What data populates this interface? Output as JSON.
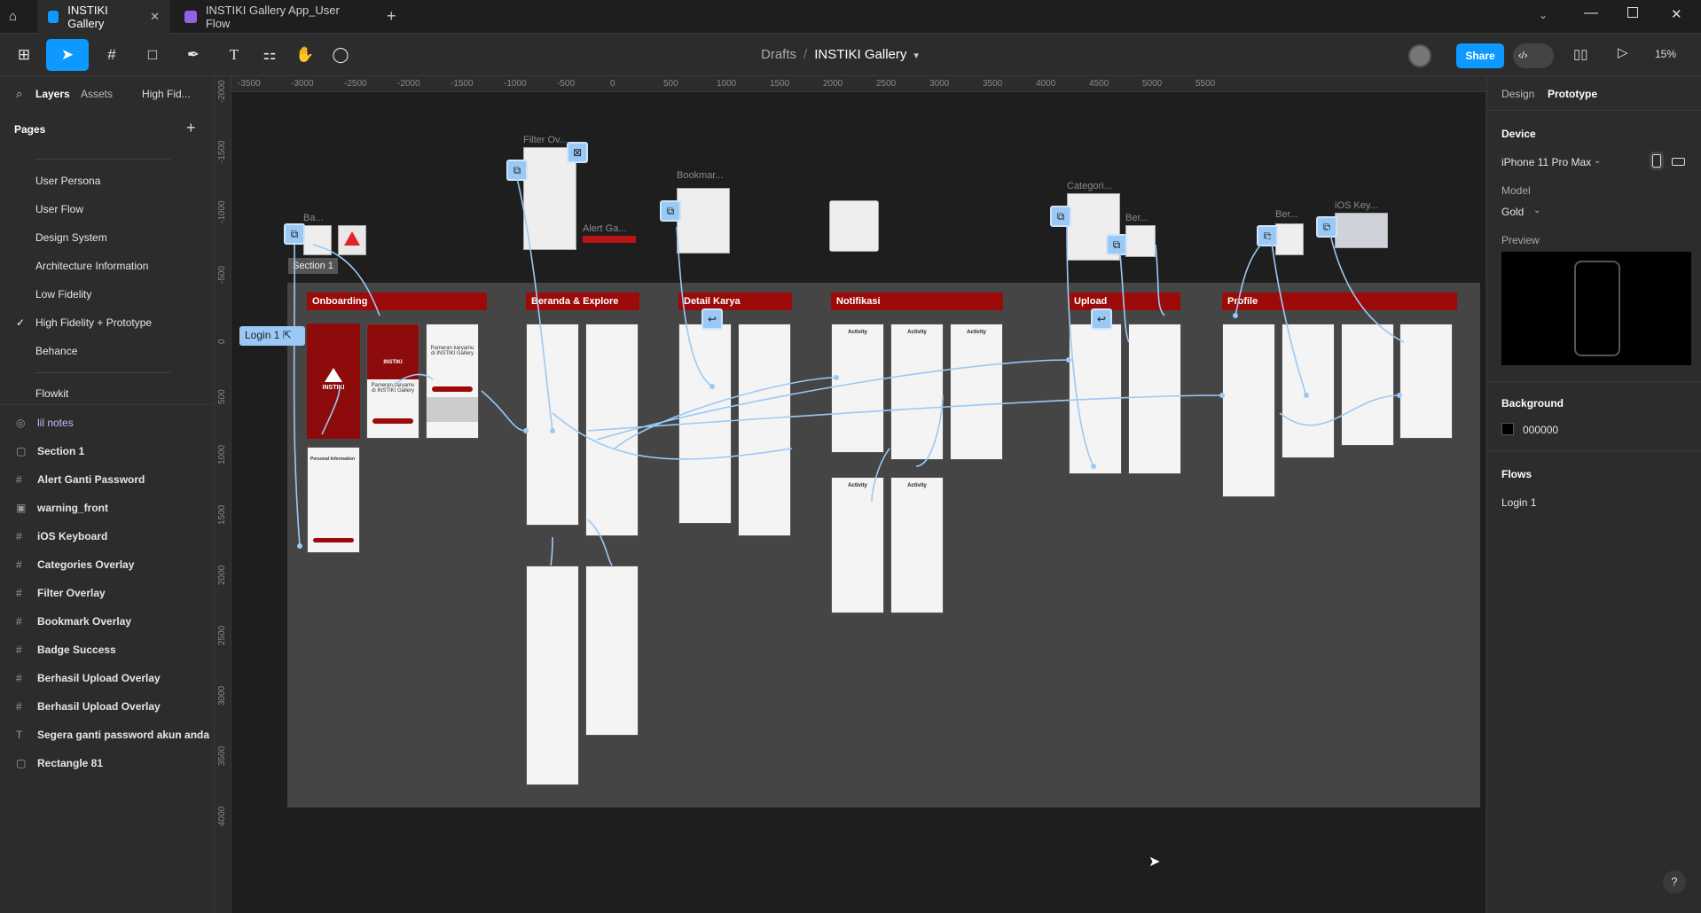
{
  "tabs": [
    {
      "label": "INSTIKI Gallery"
    },
    {
      "label": "INSTIKI Gallery App_User Flow"
    }
  ],
  "breadcrumb": {
    "root": "Drafts",
    "sep": "/",
    "file": "INSTIKI Gallery"
  },
  "toolbar": {
    "share": "Share",
    "zoom": "15%"
  },
  "left": {
    "tab_layers": "Layers",
    "tab_assets": "Assets",
    "page_select": "High Fid...",
    "pages_title": "Pages",
    "pages": [
      "User Persona",
      "User Flow",
      "Design System",
      "Architecture Information",
      "Low Fidelity",
      "High Fidelity + Prototype",
      "Behance",
      "Flowkit"
    ],
    "layers": [
      {
        "label": "lil notes",
        "icon": "◎"
      },
      {
        "label": "Section 1",
        "icon": "▢"
      },
      {
        "label": "Alert Ganti Password",
        "icon": "#"
      },
      {
        "label": "warning_front",
        "icon": "▣"
      },
      {
        "label": "iOS Keyboard",
        "icon": "#"
      },
      {
        "label": "Categories Overlay",
        "icon": "#"
      },
      {
        "label": "Filter Overlay",
        "icon": "#"
      },
      {
        "label": "Bookmark Overlay",
        "icon": "#"
      },
      {
        "label": "Badge Success",
        "icon": "#"
      },
      {
        "label": "Berhasil Upload Overlay",
        "icon": "#"
      },
      {
        "label": "Berhasil Upload Overlay",
        "icon": "#"
      },
      {
        "label": "Segera ganti password akun anda",
        "icon": "T"
      },
      {
        "label": "Rectangle 81",
        "icon": "▢"
      }
    ]
  },
  "right": {
    "tab_design": "Design",
    "tab_prototype": "Prototype",
    "device_title": "Device",
    "device": "iPhone 11 Pro Max",
    "model_label": "Model",
    "model": "Gold",
    "preview_label": "Preview",
    "background_title": "Background",
    "background_value": "000000",
    "flows_title": "Flows",
    "flow": "Login 1"
  },
  "ruler": {
    "x": [
      "-3500",
      "-3000",
      "-2500",
      "-2000",
      "-1500",
      "-1000",
      "-500",
      "0",
      "500",
      "1000",
      "1500",
      "2000",
      "2500",
      "3000",
      "3500",
      "4000",
      "4500",
      "5000",
      "5500"
    ],
    "y": [
      "-2000",
      "-1500",
      "-1000",
      "-500",
      "0",
      "500",
      "1000",
      "1500",
      "2000",
      "2500",
      "3000",
      "3500",
      "4000"
    ]
  },
  "canvas": {
    "section_label": "Section 1",
    "login_flow": "Login 1",
    "sections": [
      "Onboarding",
      "Beranda & Explore",
      "Detail Karya",
      "Notifikasi",
      "Upload",
      "Profile"
    ],
    "overlays": [
      "Filter Ov...",
      "Alert Ga...",
      "Bookmar...",
      "Categori...",
      "Ber...",
      "Ber...",
      "iOS Key...",
      "Ba..."
    ],
    "onboarding_text": [
      "INSTIKI",
      "Pameran karyamu di INSTIKI Gallery",
      "Personal Information"
    ],
    "activity": "Activity"
  },
  "colors": {
    "accent": "#0d99ff",
    "brand_red": "#9d0a0a",
    "flow_blue": "#9bc9f5"
  }
}
